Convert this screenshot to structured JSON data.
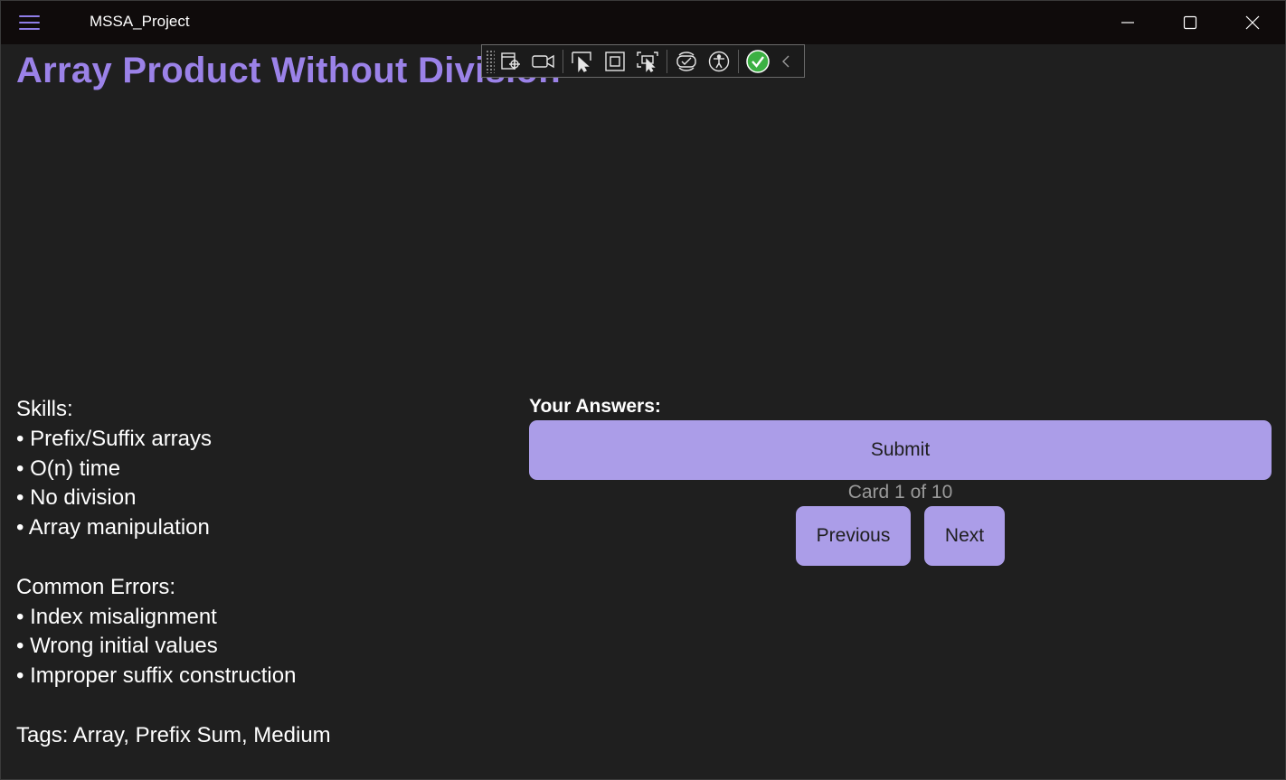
{
  "window": {
    "title": "MSSA_Project",
    "menu_icon": "hamburger-icon",
    "controls": [
      "minimize-icon",
      "maximize-icon",
      "close-icon"
    ],
    "accent": "#8f7de8"
  },
  "dev_toolbar": {
    "tools": [
      "select-element-icon",
      "video-record-icon",
      "pointer-select-icon",
      "display-layout-icon",
      "track-focus-icon",
      "hot-reload-icon",
      "accessibility-icon",
      "check-status-icon",
      "collapse-chevron-icon"
    ],
    "status_color": "#3cb043"
  },
  "card": {
    "title": "Array Product Without Division",
    "title_color": "#9b82e8",
    "skills_heading": "Skills:",
    "skills": [
      "• Prefix/Suffix arrays",
      "• O(n) time",
      "• No division",
      "• Array manipulation"
    ],
    "errors_heading": "Common Errors:",
    "errors": [
      "• Index misalignment",
      "• Wrong initial values",
      "• Improper suffix construction"
    ],
    "tags": "Tags: Array, Prefix Sum, Medium"
  },
  "answers": {
    "label": "Your Answers:",
    "submit_label": "Submit",
    "button_color": "#ab9de8"
  },
  "navigation": {
    "counter": "Card 1 of 10",
    "previous_label": "Previous",
    "next_label": "Next"
  }
}
